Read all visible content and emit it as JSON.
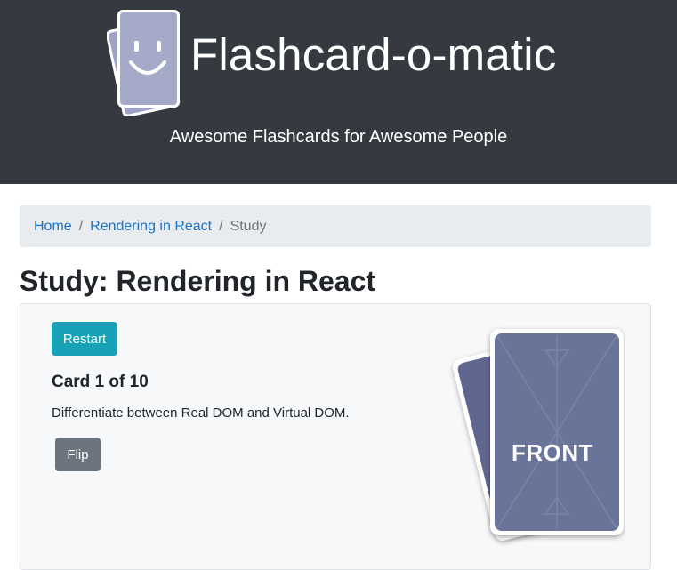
{
  "header": {
    "title": "Flashcard-o-matic",
    "subtitle": "Awesome Flashcards for Awesome People",
    "logo_icon": "smiley-flashcards-icon"
  },
  "breadcrumb": {
    "home": "Home",
    "deck": "Rendering in React",
    "current": "Study",
    "separator": "/"
  },
  "page": {
    "title": "Study: Rendering in React"
  },
  "study": {
    "restart_label": "Restart",
    "card_count": "Card 1 of 10",
    "card_text": "Differentiate between Real DOM and Virtual DOM.",
    "flip_label": "Flip",
    "card_image_label": "FRONT"
  },
  "colors": {
    "header_bg": "#343a40",
    "restart_button": "#17a2b8",
    "flip_button": "#6c757d",
    "link": "#1a73c9",
    "card_face": "#6b7398"
  }
}
